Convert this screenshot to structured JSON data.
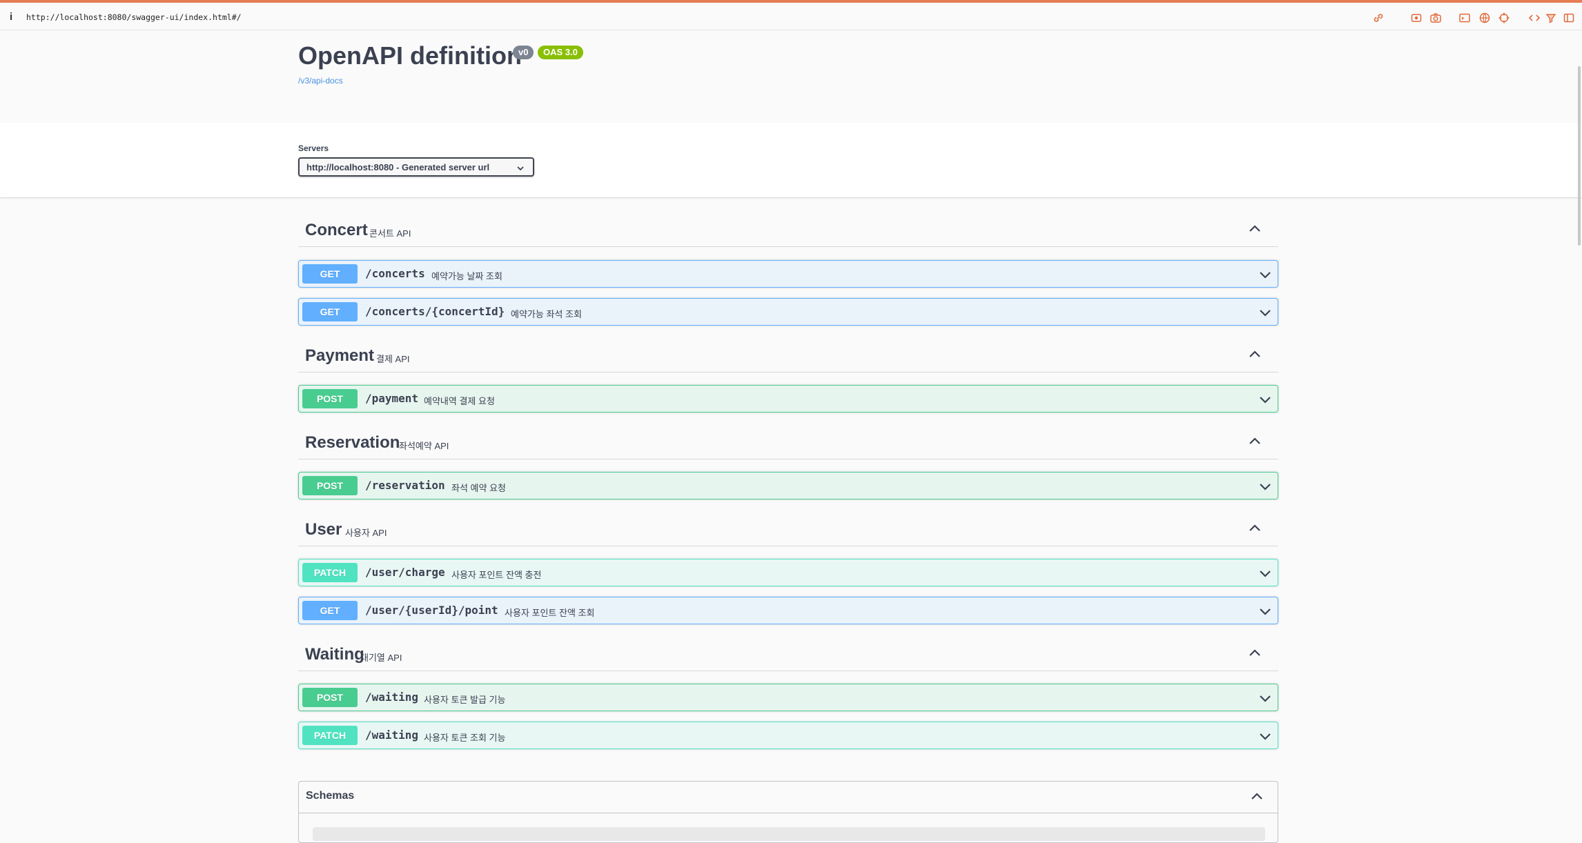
{
  "browser": {
    "url": "http://localhost:8080/swagger-ui/index.html#/",
    "info_glyph": "i"
  },
  "info": {
    "title": "OpenAPI definition",
    "version_badge": "v0",
    "oas_badge": "OAS 3.0",
    "docs_link": "/v3/api-docs"
  },
  "servers": {
    "label": "Servers",
    "selected": "http://localhost:8080 - Generated server url"
  },
  "tags": [
    {
      "name": "Concert",
      "description": "콘서트 API",
      "operations": [
        {
          "method": "GET",
          "path": "/concerts",
          "summary": "예약가능 날짜 조회"
        },
        {
          "method": "GET",
          "path": "/concerts/{concertId}",
          "summary": "예약가능 좌석 조회"
        }
      ]
    },
    {
      "name": "Payment",
      "description": "결제 API",
      "operations": [
        {
          "method": "POST",
          "path": "/payment",
          "summary": "예약내역 결제 요청"
        }
      ]
    },
    {
      "name": "Reservation",
      "description": "좌석예약 API",
      "operations": [
        {
          "method": "POST",
          "path": "/reservation",
          "summary": "좌석 예약 요청"
        }
      ]
    },
    {
      "name": "User",
      "description": "사용자 API",
      "operations": [
        {
          "method": "PATCH",
          "path": "/user/charge",
          "summary": "사용자 포인트 잔액 충전"
        },
        {
          "method": "GET",
          "path": "/user/{userId}/point",
          "summary": "사용자 포인트 잔액 조회"
        }
      ]
    },
    {
      "name": "Waiting",
      "description": "대기열 API",
      "operations": [
        {
          "method": "POST",
          "path": "/waiting",
          "summary": "사용자 토큰 발급 기능"
        },
        {
          "method": "PATCH",
          "path": "/waiting",
          "summary": "사용자 토큰 조회 기능"
        }
      ]
    }
  ],
  "schemas": {
    "title": "Schemas"
  },
  "colors": {
    "get": "#61affe",
    "post": "#49cc90",
    "patch": "#50e3c2",
    "version_badge": "#7d8492",
    "oas_badge": "#89bf04",
    "link": "#4990e2",
    "browser_accent": "#e67e55"
  }
}
